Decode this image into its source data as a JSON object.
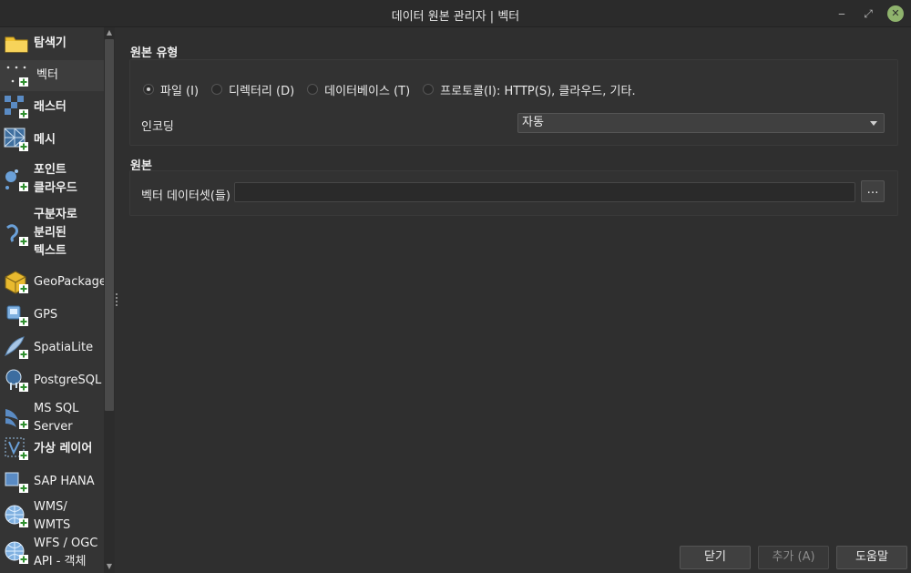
{
  "window": {
    "title": "데이터 원본 관리자 | 벡터",
    "minimize_glyph": "‒",
    "restore_glyph": "⤢",
    "close_glyph": "✕"
  },
  "sidebar": {
    "items": [
      {
        "label": "탐색기",
        "icon": "folder-icon"
      },
      {
        "label": "벡터",
        "icon": "vector-icon"
      },
      {
        "label": "래스터",
        "icon": "raster-icon"
      },
      {
        "label": "메시",
        "icon": "mesh-icon"
      },
      {
        "label": "포인트\n클라우드",
        "icon": "point-cloud-icon"
      },
      {
        "label": "구분자로\n분리된\n텍스트",
        "icon": "delimited-text-icon"
      },
      {
        "label": "GeoPackage",
        "icon": "geopackage-icon"
      },
      {
        "label": "GPS",
        "icon": "gps-icon"
      },
      {
        "label": "SpatiaLite",
        "icon": "spatialite-icon"
      },
      {
        "label": "PostgreSQL",
        "icon": "postgresql-icon"
      },
      {
        "label": "MS SQL\nServer",
        "icon": "mssql-icon"
      },
      {
        "label": "가상 레이어",
        "icon": "virtual-layer-icon"
      },
      {
        "label": "SAP HANA",
        "icon": "sap-hana-icon"
      },
      {
        "label": "WMS/\nWMTS",
        "icon": "wms-icon"
      },
      {
        "label": "WFS / OGC\nAPI - 객체",
        "icon": "wfs-icon"
      }
    ]
  },
  "source_type": {
    "title": "원본 유형",
    "options": [
      {
        "label": "파일 (I)",
        "selected": true
      },
      {
        "label": "디렉터리 (D)",
        "selected": false
      },
      {
        "label": "데이터베이스 (T)",
        "selected": false
      },
      {
        "label": "프로토콜(I): HTTP(S), 클라우드, 기타.",
        "selected": false
      }
    ],
    "encoding_label": "인코딩",
    "encoding_value": "자동"
  },
  "source": {
    "title": "원본",
    "dataset_label": "벡터 데이터셋(들)",
    "dataset_value": "",
    "browse_label": "…"
  },
  "buttons": {
    "close": "닫기",
    "add": "추가 (A)",
    "help": "도움말"
  },
  "colors": {
    "accent_green": "#8fb36d",
    "background": "#2f2f2f",
    "sidebar": "#343434"
  }
}
